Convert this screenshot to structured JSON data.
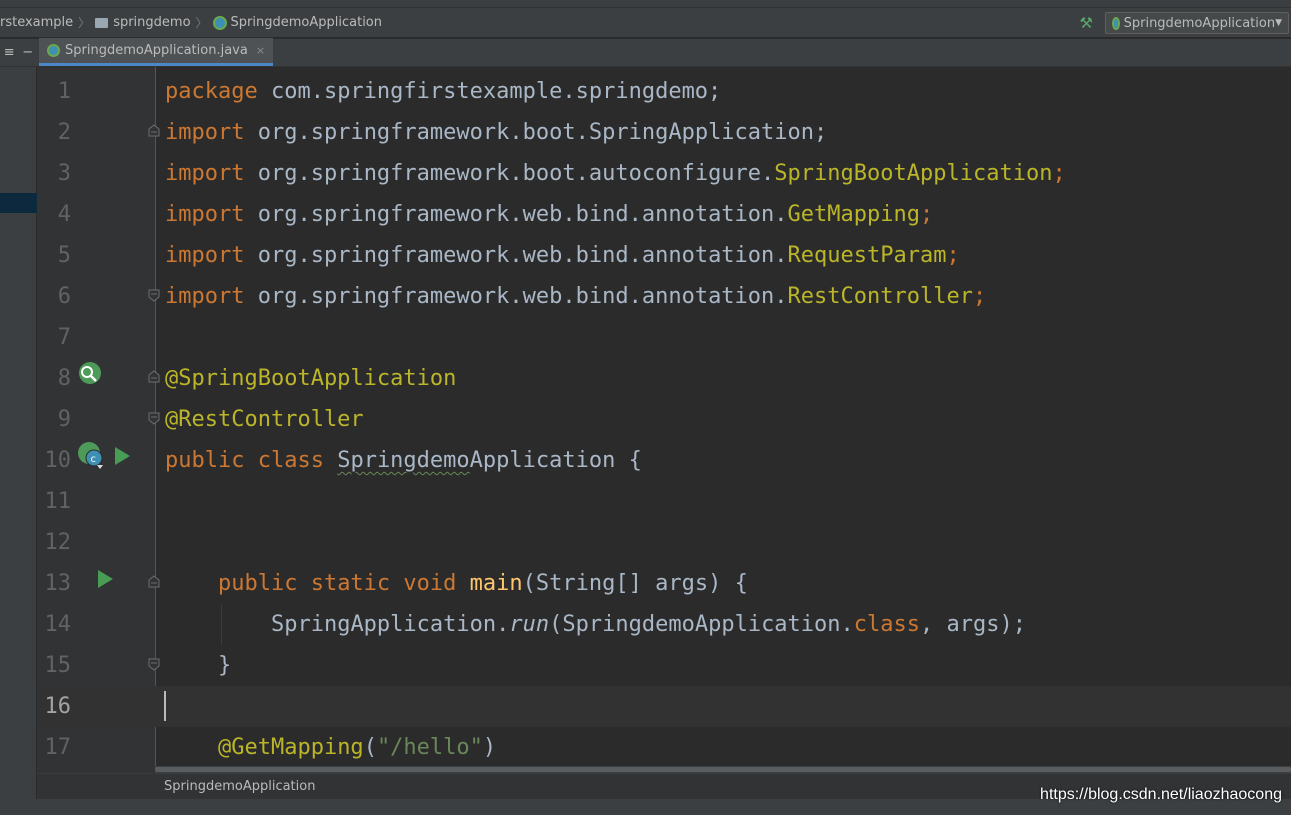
{
  "breadcrumbs": [
    "rstexample",
    "springdemo",
    "SpringdemoApplication"
  ],
  "run_config": {
    "label": "SpringdemoApplication"
  },
  "tab": {
    "label": "SpringdemoApplication.java",
    "close": "×"
  },
  "tool_icons": {
    "left": "≡",
    "right": "−"
  },
  "code_lines": [
    {
      "n": "1"
    },
    {
      "n": "2"
    },
    {
      "n": "3"
    },
    {
      "n": "4"
    },
    {
      "n": "5"
    },
    {
      "n": "6"
    },
    {
      "n": "7"
    },
    {
      "n": "8"
    },
    {
      "n": "9"
    },
    {
      "n": "10"
    },
    {
      "n": "11"
    },
    {
      "n": "12"
    },
    {
      "n": "13"
    },
    {
      "n": "14"
    },
    {
      "n": "15"
    },
    {
      "n": "16"
    },
    {
      "n": "17"
    }
  ],
  "code": {
    "l1": {
      "kw": "package",
      "rest": " com.springfirstexample.springdemo;"
    },
    "l2": {
      "kw": "import",
      "pkg": " org.springframework.boot.SpringApplication;"
    },
    "l3": {
      "kw": "import",
      "pkg": " org.springframework.boot.autoconfigure.",
      "cls": "SpringBootApplication",
      "end": ";"
    },
    "l4": {
      "kw": "import",
      "pkg": " org.springframework.web.bind.annotation.",
      "cls": "GetMapping",
      "end": ";"
    },
    "l5": {
      "kw": "import",
      "pkg": " org.springframework.web.bind.annotation.",
      "cls": "RequestParam",
      "end": ";"
    },
    "l6": {
      "kw": "import",
      "pkg": " org.springframework.web.bind.annotation.",
      "cls": "RestController",
      "end": ";"
    },
    "l8": {
      "ann": "@SpringBootApplication"
    },
    "l9": {
      "ann": "@RestController"
    },
    "l10": {
      "kw": "public class",
      "name_a": "Springdemo",
      "name_b": "Application",
      "rest": " {"
    },
    "l13": {
      "kw": "public static void",
      "fn": "main",
      "rest": "(String[] args) {"
    },
    "l14": {
      "a": "SpringApplication.",
      "run": "run",
      "b": "(SpringdemoApplication.",
      "kw": "class",
      "c": ", args);"
    },
    "l15": {
      "rest": "}"
    },
    "l17": {
      "ann": "@GetMapping",
      "open": "(",
      "str": "\"/hello\"",
      "close": ")"
    }
  },
  "structure_label": "SpringdemoApplication",
  "watermark": "https://blog.csdn.net/liaozhaocong",
  "colors": {
    "background": "#2b2b2b",
    "keyword": "#cc7832",
    "annotation": "#bbb529",
    "method": "#ffc66d",
    "string": "#6a8759",
    "text": "#a9b7c6",
    "run": "#499c54"
  }
}
